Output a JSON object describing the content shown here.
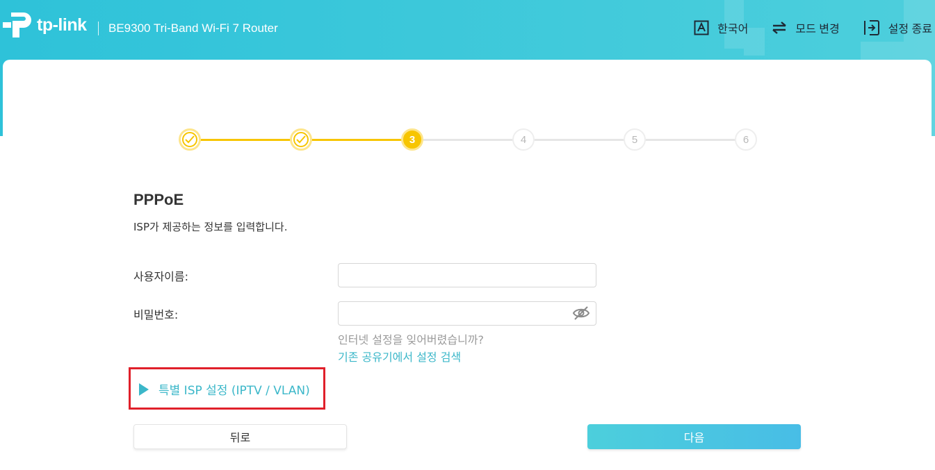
{
  "header": {
    "logo_text": "tp-link",
    "model": "BE9300 Tri-Band Wi-Fi 7 Router",
    "actions": [
      {
        "label": "한국어",
        "icon": "language-icon"
      },
      {
        "label": "모드 변경",
        "icon": "swap-arrows-icon"
      },
      {
        "label": "설정 종료",
        "icon": "exit-icon"
      }
    ]
  },
  "stepper": {
    "steps": [
      {
        "label": "",
        "state": "done"
      },
      {
        "label": "",
        "state": "done"
      },
      {
        "label": "3",
        "state": "active"
      },
      {
        "label": "4",
        "state": "todo"
      },
      {
        "label": "5",
        "state": "todo"
      },
      {
        "label": "6",
        "state": "todo"
      }
    ]
  },
  "form": {
    "title": "PPPoE",
    "subtitle": "ISP가 제공하는 정보를 입력합니다.",
    "username_label": "사용자이름:",
    "username_value": "",
    "password_label": "비밀번호:",
    "password_value": "",
    "forgot_text": "인터넷 설정을 잊어버렸습니까?",
    "search_link": "기존 공유기에서 설정 검색",
    "advanced_label": "특별 ISP 설정 (IPTV / VLAN)"
  },
  "buttons": {
    "back": "뒤로",
    "next": "다음"
  },
  "colors": {
    "header": "#2ec2d9",
    "step_done": "#f7c500",
    "link": "#3bb7c9",
    "highlight_box": "#e0202a"
  }
}
